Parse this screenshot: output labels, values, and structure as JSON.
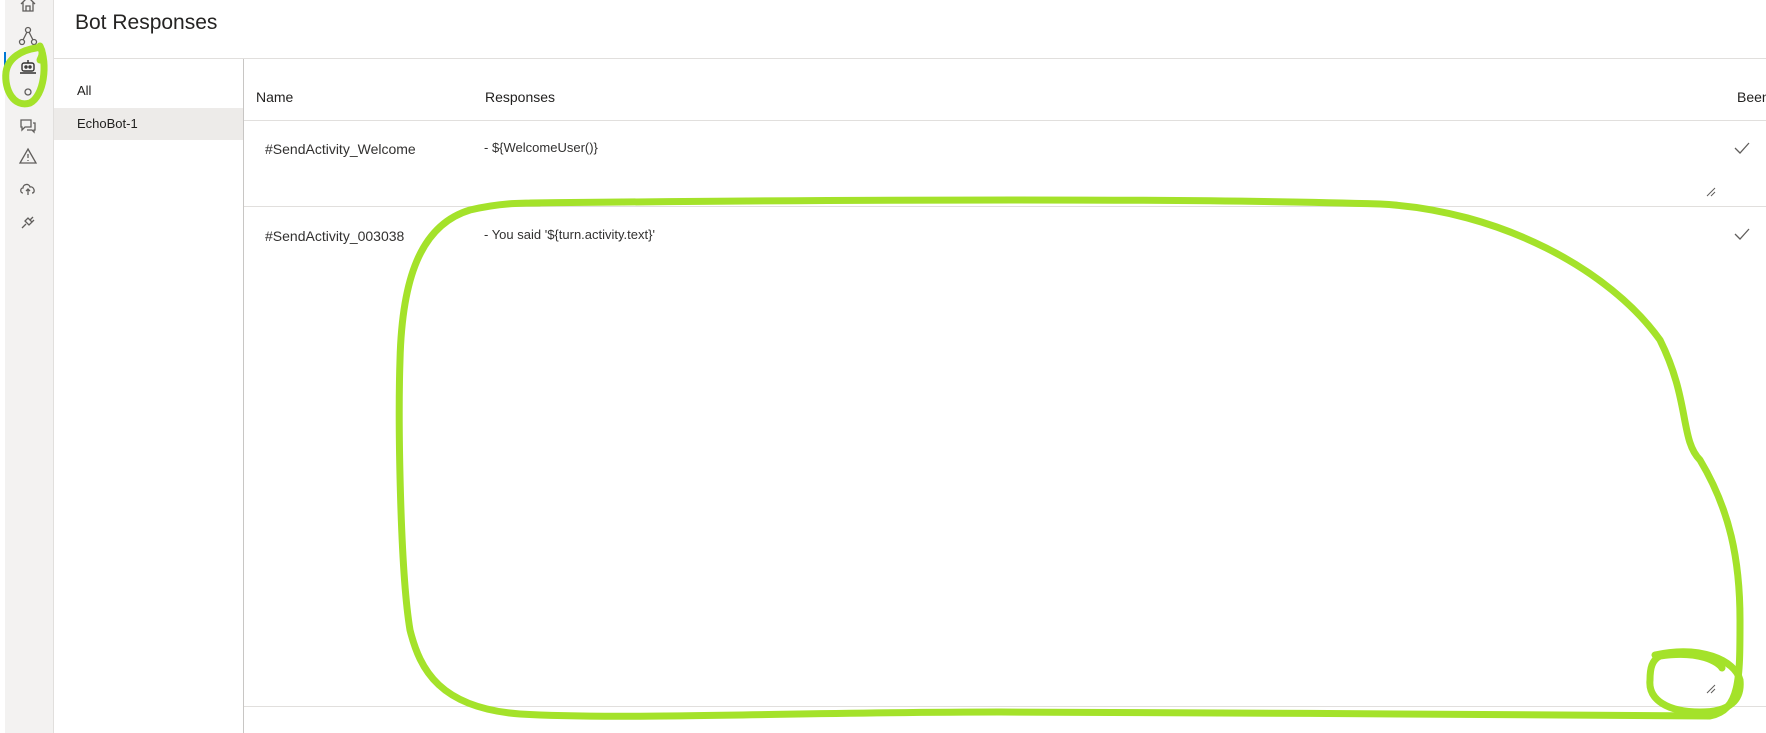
{
  "header": {
    "title": "Bot Responses"
  },
  "rail": {
    "icons": [
      "home-icon",
      "bot-flow-icon",
      "bot-responses-icon",
      "user-input-icon",
      "chat-bubbles-icon",
      "warning-icon",
      "cloud-upload-icon",
      "plug-icon"
    ],
    "active": "bot-responses-icon",
    "accent": "#0078d4"
  },
  "nav": {
    "items": [
      {
        "label": "All",
        "selected": false
      },
      {
        "label": "EchoBot-1",
        "selected": true
      }
    ]
  },
  "table": {
    "columns": [
      "Name",
      "Responses",
      "Been used"
    ],
    "rows": [
      {
        "name": "#SendActivity_Welcome",
        "response": "- ${WelcomeUser()}",
        "used": true
      },
      {
        "name": "#SendActivity_003038",
        "response": "- You said '${turn.activity.text}'",
        "used": true
      }
    ]
  },
  "annotation": {
    "color": "#a4e22a"
  }
}
